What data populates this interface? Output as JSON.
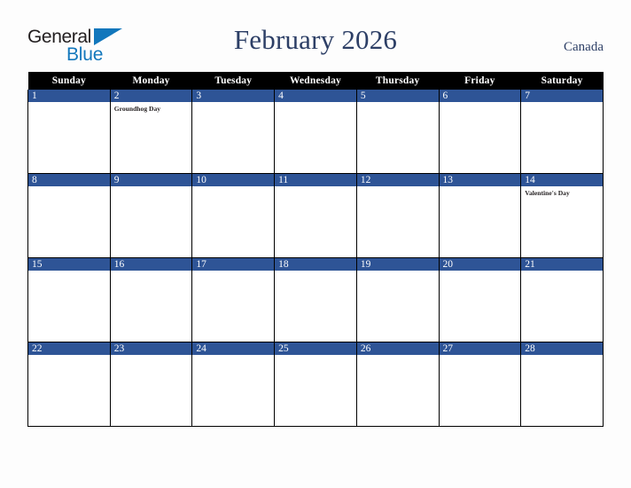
{
  "brand": {
    "name_part1": "General",
    "name_part2": "Blue",
    "pennant_icon": "blue-triangle-pennant",
    "part1_color": "#231f20",
    "part2_color": "#1277bc"
  },
  "header": {
    "title": "February 2026",
    "country": "Canada",
    "title_color": "#2d3f66"
  },
  "calendar": {
    "month": "February",
    "year": "2026",
    "header_background": "#000000",
    "header_text_color": "#ffffff",
    "date_band_color": "#2e5496",
    "cell_background": "#ffffff",
    "border_color": "#000000",
    "weekdays": [
      "Sunday",
      "Monday",
      "Tuesday",
      "Wednesday",
      "Thursday",
      "Friday",
      "Saturday"
    ],
    "weeks": [
      [
        {
          "day": "1",
          "event": ""
        },
        {
          "day": "2",
          "event": "Groundhog Day"
        },
        {
          "day": "3",
          "event": ""
        },
        {
          "day": "4",
          "event": ""
        },
        {
          "day": "5",
          "event": ""
        },
        {
          "day": "6",
          "event": ""
        },
        {
          "day": "7",
          "event": ""
        }
      ],
      [
        {
          "day": "8",
          "event": ""
        },
        {
          "day": "9",
          "event": ""
        },
        {
          "day": "10",
          "event": ""
        },
        {
          "day": "11",
          "event": ""
        },
        {
          "day": "12",
          "event": ""
        },
        {
          "day": "13",
          "event": ""
        },
        {
          "day": "14",
          "event": "Valentine's Day"
        }
      ],
      [
        {
          "day": "15",
          "event": ""
        },
        {
          "day": "16",
          "event": ""
        },
        {
          "day": "17",
          "event": ""
        },
        {
          "day": "18",
          "event": ""
        },
        {
          "day": "19",
          "event": ""
        },
        {
          "day": "20",
          "event": ""
        },
        {
          "day": "21",
          "event": ""
        }
      ],
      [
        {
          "day": "22",
          "event": ""
        },
        {
          "day": "23",
          "event": ""
        },
        {
          "day": "24",
          "event": ""
        },
        {
          "day": "25",
          "event": ""
        },
        {
          "day": "26",
          "event": ""
        },
        {
          "day": "27",
          "event": ""
        },
        {
          "day": "28",
          "event": ""
        }
      ]
    ]
  }
}
